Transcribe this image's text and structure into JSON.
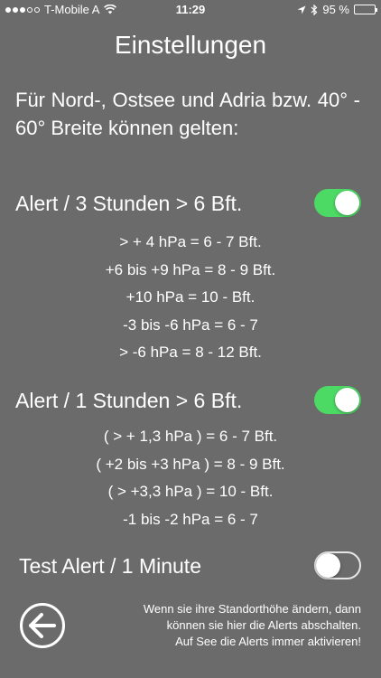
{
  "status_bar": {
    "carrier": "T-Mobile A",
    "time": "11:29",
    "battery": "95 %",
    "icons": [
      "signal-dots-icon",
      "wifi-icon",
      "location-arrow-icon",
      "bluetooth-icon",
      "battery-icon"
    ]
  },
  "page_title": "Einstellungen",
  "intro": "Für Nord-, Ostsee  und Adria bzw. 40° - 60° Breite können gelten:",
  "alert_3h": {
    "label": "Alert / 3 Stunden > 6 Bft.",
    "enabled": true,
    "rules": [
      "> + 4 hPa = 6 - 7 Bft.",
      "+6 bis +9 hPa = 8 - 9 Bft.",
      "+10 hPa = 10 - Bft.",
      "-3 bis -6 hPa = 6 - 7",
      "> -6 hPa = 8 - 12 Bft."
    ]
  },
  "alert_1h": {
    "label": "Alert / 1 Stunden > 6 Bft.",
    "enabled": true,
    "rules": [
      "( > + 1,3 hPa ) = 6 - 7 Bft.",
      "( +2 bis +3 hPa ) = 8 - 9 Bft.",
      "( > +3,3 hPa ) = 10 - Bft.",
      "-1 bis -2 hPa = 6 - 7"
    ]
  },
  "test_alert": {
    "label": "Test Alert / 1 Minute",
    "enabled": false
  },
  "footer": {
    "line1": "Wenn sie ihre Standorthöhe ändern, dann",
    "line2": "können sie hier die Alerts abschalten.",
    "line3": "Auf See die Alerts immer aktivieren!"
  },
  "colors": {
    "background": "#6b6b6b",
    "toggle_on": "#4cd964",
    "text": "#ffffff"
  }
}
